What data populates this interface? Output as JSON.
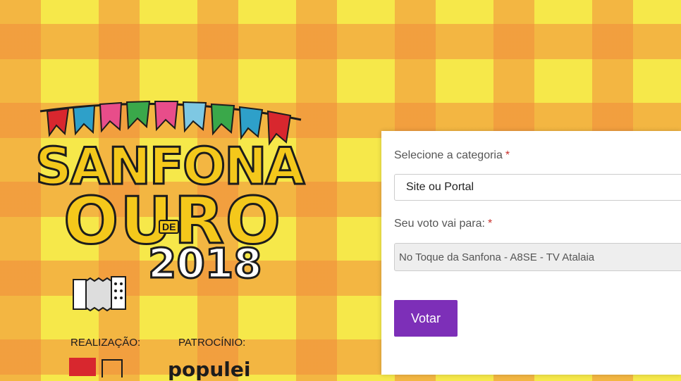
{
  "logo": {
    "title_line1": "SANFONA",
    "title_de": "DE",
    "title_line2": "OURO",
    "year": "2018"
  },
  "sponsors": {
    "realizacao_label": "REALIZAÇÃO:",
    "patrocinio_label": "PATROCÍNIO:",
    "patrocinio_logo_text": "populei"
  },
  "form": {
    "category_label": "Selecione a categoria",
    "category_value": "Site ou Portal",
    "vote_label": "Seu voto vai para:",
    "vote_value": "No Toque da Sanfona - A8SE - TV Atalaia",
    "required_mark": "*",
    "submit_label": "Votar"
  },
  "colors": {
    "accent": "#7d2fb8",
    "required": "#c9302c",
    "background_yellow": "#f6e84a",
    "background_orange": "#f08c3c"
  }
}
